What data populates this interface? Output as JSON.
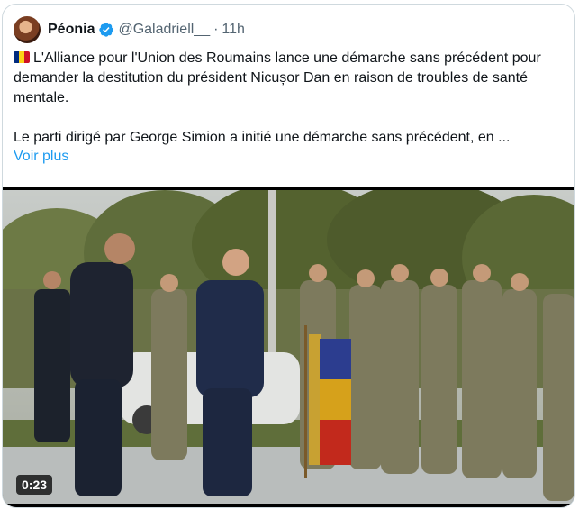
{
  "author": {
    "display_name": "Péonia",
    "handle": "@Galadriell__",
    "time": "11h",
    "separator": "·",
    "verified_icon": "verified-badge-icon",
    "verified_color": "#1d9bf0"
  },
  "tweet": {
    "flag": "romania-flag-icon",
    "paragraph1": "L'Alliance pour l'Union des Roumains lance une démarche sans précédent pour demander la destitution du président Nicușor Dan en raison de troubles de santé mentale.",
    "paragraph2": "Le parti dirigé par George Simion a initié une démarche sans précédent, en ...",
    "show_more": "Voir plus"
  },
  "media": {
    "type": "video",
    "duration": "0:23"
  },
  "colors": {
    "link": "#1d9bf0",
    "secondary_text": "#536471",
    "border": "#cfd9de"
  }
}
